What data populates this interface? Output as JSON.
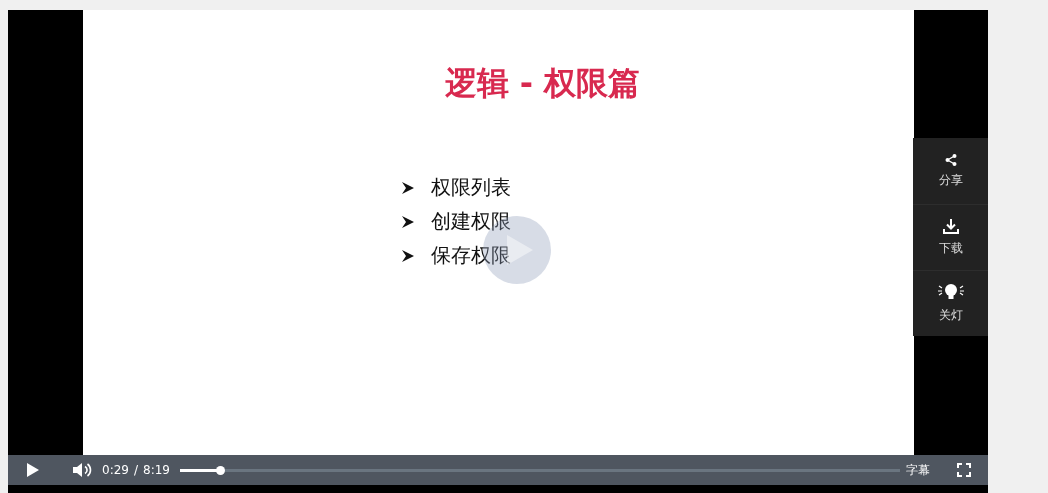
{
  "slide": {
    "title": "逻辑 - 权限篇",
    "bullets": [
      "权限列表",
      "创建权限",
      "保存权限"
    ]
  },
  "side_menu": [
    {
      "kind": "share",
      "label": "分享"
    },
    {
      "kind": "download",
      "label": "下载"
    },
    {
      "kind": "light",
      "label": "关灯"
    }
  ],
  "controls": {
    "playing": false,
    "muted": false,
    "current_time": "0:29",
    "separator": "/",
    "duration": "8:19",
    "progress": {
      "level": 0.055
    },
    "subtitles": "字幕"
  }
}
